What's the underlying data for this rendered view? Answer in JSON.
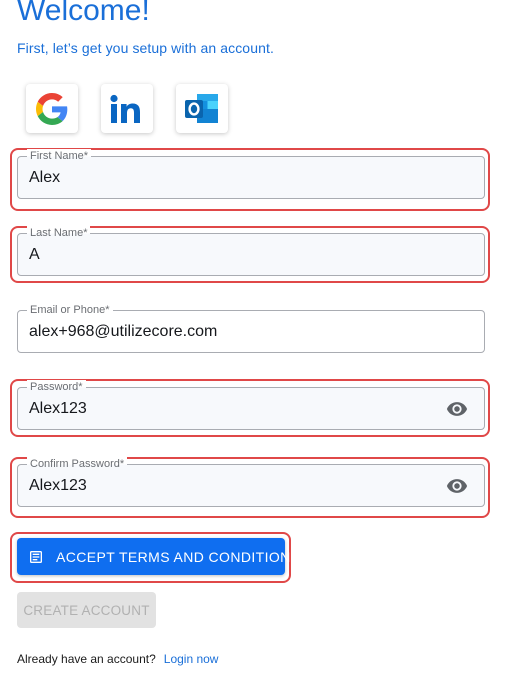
{
  "header": {
    "title": "Welcome!",
    "subtitle": "First, let’s get you setup with an account."
  },
  "social_login": [
    "google-icon",
    "linkedin-icon",
    "outlook-icon"
  ],
  "form": {
    "first_name": {
      "label": "First Name*",
      "value": "Alex"
    },
    "last_name": {
      "label": "Last Name*",
      "value": "A"
    },
    "email": {
      "label": "Email or Phone*",
      "value": "alex+968@utilizecore.com"
    },
    "password": {
      "label": "Password*",
      "value": "Alex123"
    },
    "confirm_password": {
      "label": "Confirm Password*",
      "value": "Alex123"
    }
  },
  "actions": {
    "accept_terms_label": "ACCEPT TERMS AND CONDITIONS",
    "create_account_label": "CREATE ACCOUNT"
  },
  "footer": {
    "prompt": "Already have an account?",
    "login_link": "Login now"
  },
  "colors": {
    "accent": "#1a6fd8",
    "primary_button": "#0f6ef0",
    "highlight_outline": "#e04848",
    "disabled_button": "#e2e2e2"
  }
}
